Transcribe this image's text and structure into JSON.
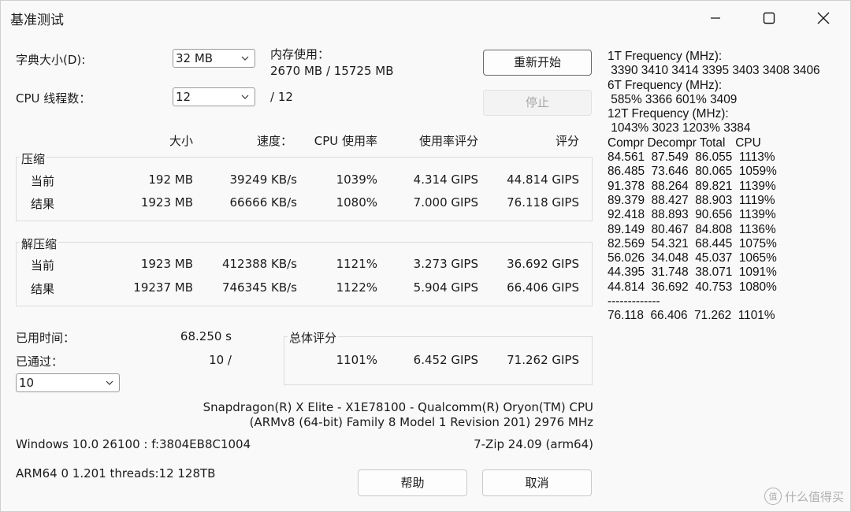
{
  "window": {
    "title": "基准测试",
    "minimize_glyph": "—",
    "maximize_glyph": "☐",
    "close_glyph": "✕"
  },
  "dictionary": {
    "label": "字典大小(D):",
    "value": "32 MB"
  },
  "memory": {
    "label": "内存使用：",
    "value": "2670 MB / 15725 MB"
  },
  "threads": {
    "label": "CPU 线程数：",
    "value": "12",
    "max": "/ 12"
  },
  "buttons": {
    "restart": "重新开始",
    "stop": "停止",
    "help": "帮助",
    "cancel": "取消"
  },
  "columns": {
    "size": "大小",
    "speed": "速度：",
    "usage": "CPU 使用率",
    "rating_usage": "使用率评分",
    "rating": "评分"
  },
  "compress": {
    "title": "压缩",
    "rows": [
      {
        "label": "当前",
        "size": "192 MB",
        "speed": "39249 KB/s",
        "usage": "1039%",
        "rating_usage": "4.314 GIPS",
        "rating": "44.814 GIPS"
      },
      {
        "label": "结果",
        "size": "1923 MB",
        "speed": "66666 KB/s",
        "usage": "1080%",
        "rating_usage": "7.000 GIPS",
        "rating": "76.118 GIPS"
      }
    ]
  },
  "decompress": {
    "title": "解压缩",
    "rows": [
      {
        "label": "当前",
        "size": "1923 MB",
        "speed": "412388 KB/s",
        "usage": "1121%",
        "rating_usage": "3.273 GIPS",
        "rating": "36.692 GIPS"
      },
      {
        "label": "结果",
        "size": "19237 MB",
        "speed": "746345 KB/s",
        "usage": "1122%",
        "rating_usage": "5.904 GIPS",
        "rating": "66.406 GIPS"
      }
    ]
  },
  "elapsed": {
    "label": "已用时间：",
    "value": "68.250 s"
  },
  "passes": {
    "label": "已通过：",
    "value": "10 /",
    "selected": "10"
  },
  "total": {
    "title": "总体评分",
    "usage": "1101%",
    "rating_usage": "6.452 GIPS",
    "rating": "71.262 GIPS"
  },
  "cpu_info": {
    "line1": "Snapdragon(R) X Elite - X1E78100 - Qualcomm(R) Oryon(TM) CPU",
    "line2": "(ARMv8 (64-bit) Family 8 Model 1 Revision 201) 2976 MHz"
  },
  "os_info": "Windows 10.0 26100 :  f:3804EB8C1004",
  "app_version": "7-Zip 24.09 (arm64)",
  "arch_info": "ARM64 0 1.201 threads:12 128TB",
  "console": [
    "1T Frequency (MHz):",
    " 3390 3410 3414 3395 3403 3408 3406",
    "6T Frequency (MHz):",
    " 585% 3366 601% 3409",
    "12T Frequency (MHz):",
    " 1043% 3023 1203% 3384",
    "Compr Decompr Total   CPU",
    "84.561  87.549  86.055  1113%",
    "86.485  73.646  80.065  1059%",
    "91.378  88.264  89.821  1139%",
    "89.379  88.427  88.903  1119%",
    "92.418  88.893  90.656  1139%",
    "89.149  80.467  84.808  1136%",
    "82.569  54.321  68.445  1075%",
    "56.026  34.048  45.037  1065%",
    "44.395  31.748  38.071  1091%",
    "44.814  36.692  40.753  1080%",
    "-------------",
    "76.118  66.406  71.262  1101%"
  ],
  "watermark": {
    "icon": "值",
    "text": "什么值得买"
  }
}
